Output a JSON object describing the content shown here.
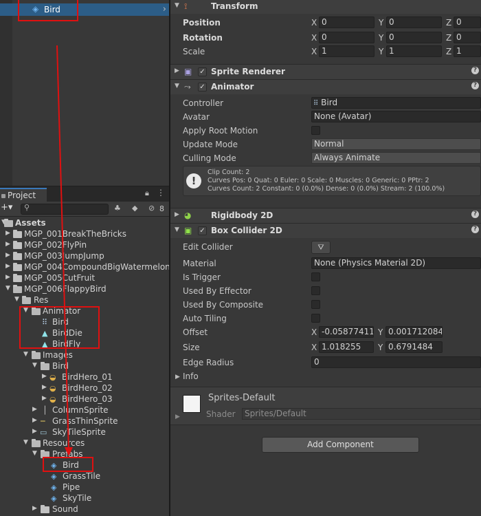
{
  "hierarchy": {
    "selected_item": "Bird"
  },
  "project": {
    "tab_label": "Project",
    "search_placeholder": "",
    "hidden_count": "8",
    "tree": [
      {
        "label": "Assets",
        "bold": true
      },
      {
        "label": "MGP_001BreakTheBricks"
      },
      {
        "label": "MGP_002FlyPin"
      },
      {
        "label": "MGP_003JumpJump"
      },
      {
        "label": "MGP_004CompoundBigWatermelon"
      },
      {
        "label": "MGP_005CutFruit"
      },
      {
        "label": "MGP_006FlappyBird"
      },
      {
        "label": "Res"
      },
      {
        "label": "Animator"
      },
      {
        "label": "Bird"
      },
      {
        "label": "BirdDie"
      },
      {
        "label": "BirdFly"
      },
      {
        "label": "Images"
      },
      {
        "label": "Bird"
      },
      {
        "label": "BirdHero_01"
      },
      {
        "label": "BirdHero_02"
      },
      {
        "label": "BirdHero_03"
      },
      {
        "label": "ColumnSprite"
      },
      {
        "label": "GrassThinSprite"
      },
      {
        "label": "SkyTileSprite"
      },
      {
        "label": "Resources"
      },
      {
        "label": "Prefabs"
      },
      {
        "label": "Bird"
      },
      {
        "label": "GrassTile"
      },
      {
        "label": "Pipe"
      },
      {
        "label": "SkyTile"
      },
      {
        "label": "Sound"
      }
    ]
  },
  "inspector": {
    "transform": {
      "title": "Transform",
      "position_label": "Position",
      "rotation_label": "Rotation",
      "scale_label": "Scale",
      "position": {
        "x": "0",
        "y": "0",
        "z": "0"
      },
      "rotation": {
        "x": "0",
        "y": "0",
        "z": "0"
      },
      "scale": {
        "x": "1",
        "y": "1",
        "z": "1"
      }
    },
    "sprite_renderer": {
      "title": "Sprite Renderer"
    },
    "animator": {
      "title": "Animator",
      "controller_label": "Controller",
      "controller_value": "Bird",
      "avatar_label": "Avatar",
      "avatar_value": "None (Avatar)",
      "apply_root_motion_label": "Apply Root Motion",
      "update_mode_label": "Update Mode",
      "update_mode_value": "Normal",
      "culling_mode_label": "Culling Mode",
      "culling_mode_value": "Always Animate",
      "info_line1": "Clip Count: 2",
      "info_line2": "Curves Pos: 0 Quat: 0 Euler: 0 Scale: 0 Muscles: 0 Generic: 0 PPtr: 2",
      "info_line3": "Curves Count: 2 Constant: 0 (0.0%) Dense: 0 (0.0%) Stream: 2 (100.0%)"
    },
    "rigidbody2d": {
      "title": "Rigidbody 2D"
    },
    "box_collider": {
      "title": "Box Collider 2D",
      "edit_collider_label": "Edit Collider",
      "material_label": "Material",
      "material_value": "None (Physics Material 2D)",
      "is_trigger_label": "Is Trigger",
      "used_by_effector_label": "Used By Effector",
      "used_by_composite_label": "Used By Composite",
      "auto_tiling_label": "Auto Tiling",
      "offset_label": "Offset",
      "offset": {
        "x": "-0.05877411",
        "y": "0.001712084"
      },
      "size_label": "Size",
      "size": {
        "x": "1.018255",
        "y": "0.6791484"
      },
      "edge_radius_label": "Edge Radius",
      "edge_radius_value": "0",
      "info_label": "Info"
    },
    "material": {
      "name": "Sprites-Default",
      "shader_label": "Shader",
      "shader_value": "Sprites/Default"
    },
    "add_component_label": "Add Component",
    "axis_x": "X",
    "axis_y": "Y",
    "axis_z": "Z"
  },
  "annotation_color": "#e01010"
}
